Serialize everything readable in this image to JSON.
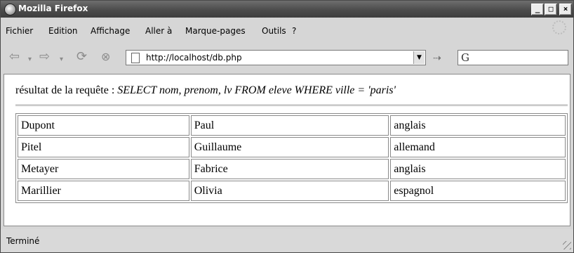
{
  "window": {
    "title": "Mozilla Firefox"
  },
  "menu": {
    "items": [
      "Fichier",
      "Edition",
      "Affichage",
      "Aller à",
      "Marque-pages",
      "Outils",
      "?"
    ]
  },
  "nav": {
    "url": "http://localhost/db.php",
    "search_engine_icon": "google-icon"
  },
  "content": {
    "query_label": "résultat de la requête : ",
    "query_text": "SELECT nom, prenom, lv FROM eleve WHERE ville = 'paris'",
    "rows": [
      [
        "Dupont",
        "Paul",
        "anglais"
      ],
      [
        "Pitel",
        "Guillaume",
        "allemand"
      ],
      [
        "Metayer",
        "Fabrice",
        "anglais"
      ],
      [
        "Marillier",
        "Olivia",
        "espagnol"
      ]
    ]
  },
  "status": {
    "text": "Terminé"
  }
}
